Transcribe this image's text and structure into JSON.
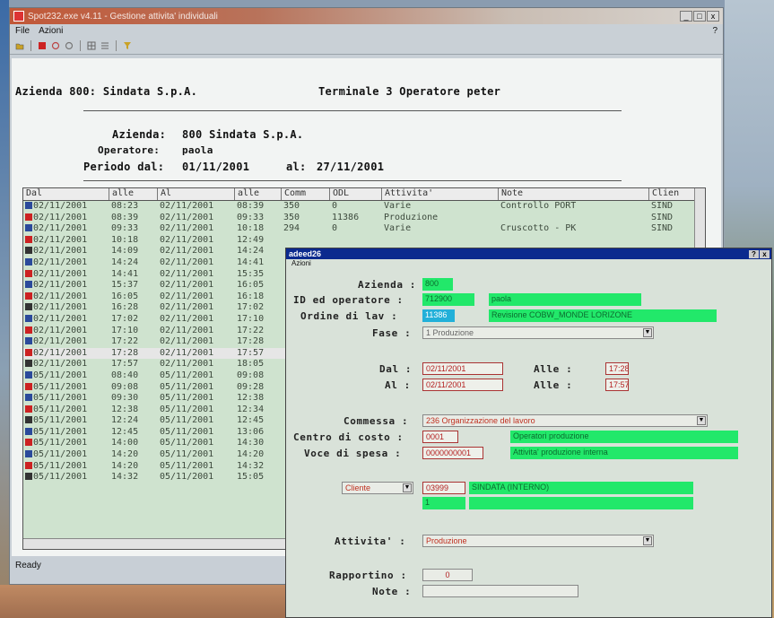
{
  "window": {
    "title": "Spot232.exe v4.11 - Gestione attivita' individuali",
    "menu": [
      "File",
      "Azioni"
    ],
    "help": "?",
    "btn_min": "_",
    "btn_max": "□",
    "btn_close": "x",
    "status": "Ready"
  },
  "header": {
    "azienda_line": "Azienda 800: Sindata S.p.A.",
    "terminale_line": "Terminale  3 Operatore peter",
    "azienda_label": "Azienda:",
    "azienda_value": "800 Sindata S.p.A.",
    "operatore_label": "Operatore:",
    "operatore_value": "paola",
    "periodo_label": "Periodo dal:",
    "periodo_dal": "01/11/2001",
    "periodo_al_label": "al:",
    "periodo_al": "27/11/2001"
  },
  "table": {
    "columns": [
      "Dal",
      "alle",
      "Al",
      "alle",
      "Comm",
      "ODL",
      "Attivita'",
      "Note",
      "Clien"
    ],
    "rows": [
      [
        "02/11/2001",
        "08:23",
        "02/11/2001",
        "08:39",
        "350",
        "0",
        "Varie",
        "Controllo PORT",
        "SIND"
      ],
      [
        "02/11/2001",
        "08:39",
        "02/11/2001",
        "09:33",
        "350",
        "11386",
        "Produzione",
        "",
        "SIND"
      ],
      [
        "02/11/2001",
        "09:33",
        "02/11/2001",
        "10:18",
        "294",
        "0",
        "Varie",
        "Cruscotto - PK",
        "SIND"
      ],
      [
        "02/11/2001",
        "10:18",
        "02/11/2001",
        "12:49",
        "",
        "",
        "",
        "",
        ""
      ],
      [
        "02/11/2001",
        "14:09",
        "02/11/2001",
        "14:24",
        "",
        "",
        "",
        "",
        ""
      ],
      [
        "02/11/2001",
        "14:24",
        "02/11/2001",
        "14:41",
        "",
        "",
        "",
        "",
        ""
      ],
      [
        "02/11/2001",
        "14:41",
        "02/11/2001",
        "15:35",
        "",
        "",
        "",
        "",
        ""
      ],
      [
        "02/11/2001",
        "15:37",
        "02/11/2001",
        "16:05",
        "",
        "",
        "",
        "",
        ""
      ],
      [
        "02/11/2001",
        "16:05",
        "02/11/2001",
        "16:18",
        "",
        "",
        "",
        "",
        ""
      ],
      [
        "02/11/2001",
        "16:28",
        "02/11/2001",
        "17:02",
        "",
        "",
        "",
        "",
        ""
      ],
      [
        "02/11/2001",
        "17:02",
        "02/11/2001",
        "17:10",
        "",
        "",
        "",
        "",
        ""
      ],
      [
        "02/11/2001",
        "17:10",
        "02/11/2001",
        "17:22",
        "",
        "",
        "",
        "",
        ""
      ],
      [
        "02/11/2001",
        "17:22",
        "02/11/2001",
        "17:28",
        "",
        "",
        "",
        "",
        ""
      ],
      [
        "02/11/2001",
        "17:28",
        "02/11/2001",
        "17:57",
        "",
        "",
        "",
        "",
        ""
      ],
      [
        "02/11/2001",
        "17:57",
        "02/11/2001",
        "18:05",
        "",
        "",
        "",
        "",
        ""
      ],
      [
        "05/11/2001",
        "08:40",
        "05/11/2001",
        "09:08",
        "",
        "",
        "",
        "",
        ""
      ],
      [
        "05/11/2001",
        "09:08",
        "05/11/2001",
        "09:28",
        "",
        "",
        "",
        "",
        ""
      ],
      [
        "05/11/2001",
        "09:30",
        "05/11/2001",
        "12:38",
        "",
        "",
        "",
        "",
        ""
      ],
      [
        "05/11/2001",
        "12:38",
        "05/11/2001",
        "12:34",
        "",
        "",
        "",
        "",
        ""
      ],
      [
        "05/11/2001",
        "12:24",
        "05/11/2001",
        "12:45",
        "",
        "",
        "",
        "",
        ""
      ],
      [
        "05/11/2001",
        "12:45",
        "05/11/2001",
        "13:06",
        "",
        "",
        "",
        "",
        ""
      ],
      [
        "05/11/2001",
        "14:00",
        "05/11/2001",
        "14:30",
        "",
        "",
        "",
        "",
        ""
      ],
      [
        "05/11/2001",
        "14:20",
        "05/11/2001",
        "14:20",
        "",
        "",
        "",
        "",
        ""
      ],
      [
        "05/11/2001",
        "14:20",
        "05/11/2001",
        "14:32",
        "",
        "",
        "",
        "",
        ""
      ],
      [
        "05/11/2001",
        "14:32",
        "05/11/2001",
        "15:05",
        "",
        "",
        "",
        "",
        ""
      ]
    ]
  },
  "dialog": {
    "title": "adeed26",
    "menu": "Azioni",
    "help": "?",
    "close": "x",
    "azienda_label": "Azienda :",
    "azienda_value": "800",
    "operatore_label": "ID ed operatore :",
    "operatore_id": "712900",
    "operatore_name": "paola",
    "ordine_label": "Ordine di lav :",
    "ordine_id": "11386",
    "ordine_desc": "Revisione COBW_MONDE LORIZONE",
    "fase_label": "Fase :",
    "fase_value": "1 Produzione",
    "dal_label": "Dal :",
    "dal_value": "02/11/2001",
    "alle1_label": "Alle :",
    "alle1_value": "17:28",
    "al_label": "Al :",
    "al_value": "02/11/2001",
    "alle2_label": "Alle :",
    "alle2_value": "17:57",
    "commessa_label": "Commessa :",
    "commessa_value": "236 Organizzazione del lavoro",
    "centro_label": "Centro di costo :",
    "centro_code": "0001",
    "centro_desc": "Operatori produzione",
    "voce_label": "Voce di spesa :",
    "voce_code": "0000000001",
    "voce_desc": "Attivita' produzione interna",
    "cliente_combo": "Cliente",
    "cliente_code": "03999",
    "cliente_name": "SINDATA (INTERNO)",
    "cliente_sub": "1",
    "attivita_label": "Attivita' :",
    "attivita_value": "Produzione",
    "rapportino_label": "Rapportino :",
    "rapportino_value": "0",
    "note_label": "Note :",
    "note_value": ""
  }
}
